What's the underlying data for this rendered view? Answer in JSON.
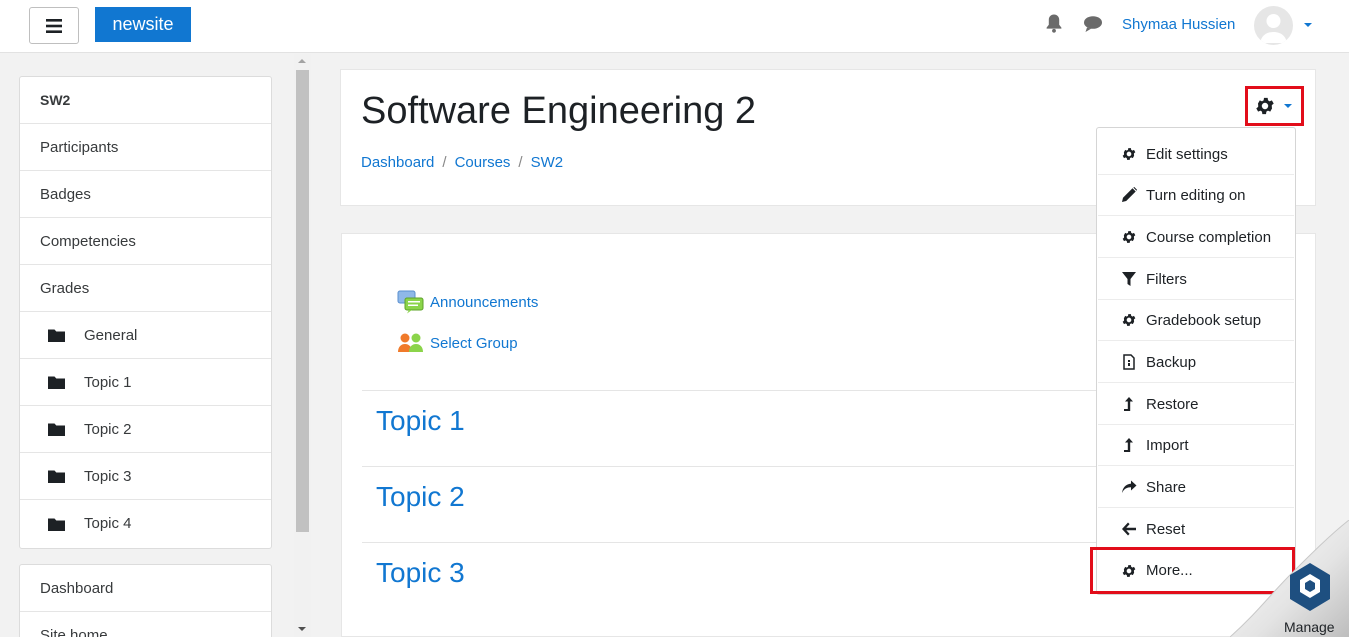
{
  "navbar": {
    "brand": "newsite",
    "user_name": "Shymaa Hussien",
    "icons": {
      "menu": "hamburger-icon",
      "notifications": "bell-icon",
      "messages": "chat-icon"
    }
  },
  "sidebar": {
    "course_items": [
      {
        "label": "SW2",
        "bold": true
      },
      {
        "label": "Participants"
      },
      {
        "label": "Badges"
      },
      {
        "label": "Competencies"
      },
      {
        "label": "Grades"
      },
      {
        "label": "General",
        "folder": true
      },
      {
        "label": "Topic 1",
        "folder": true
      },
      {
        "label": "Topic 2",
        "folder": true
      },
      {
        "label": "Topic 3",
        "folder": true
      },
      {
        "label": "Topic 4",
        "folder": true
      }
    ],
    "site_items": [
      {
        "label": "Dashboard"
      },
      {
        "label": "Site home"
      }
    ]
  },
  "header": {
    "title": "Software Engineering 2",
    "breadcrumb": [
      "Dashboard",
      "Courses",
      "SW2"
    ],
    "breadcrumb_separator": "/"
  },
  "content": {
    "activities": [
      {
        "label": "Announcements",
        "icon": "forum-icon"
      },
      {
        "label": "Select Group",
        "icon": "group-icon"
      }
    ],
    "topics": [
      "Topic 1",
      "Topic 2",
      "Topic 3"
    ]
  },
  "actions_menu": {
    "items": [
      {
        "label": "Edit settings",
        "icon": "gear-icon"
      },
      {
        "label": "Turn editing on",
        "icon": "pencil-icon"
      },
      {
        "label": "Course completion",
        "icon": "gear-icon"
      },
      {
        "label": "Filters",
        "icon": "filter-icon"
      },
      {
        "label": "Gradebook setup",
        "icon": "gear-icon"
      },
      {
        "label": "Backup",
        "icon": "file-icon"
      },
      {
        "label": "Restore",
        "icon": "upload-icon"
      },
      {
        "label": "Import",
        "icon": "upload-icon"
      },
      {
        "label": "Share",
        "icon": "share-icon"
      },
      {
        "label": "Reset",
        "icon": "arrow-left-icon"
      },
      {
        "label": "More...",
        "icon": "gear-icon"
      }
    ]
  },
  "manage": {
    "label": "Manage"
  },
  "colors": {
    "brand": "#1177d1",
    "highlight": "#e20d1a"
  }
}
